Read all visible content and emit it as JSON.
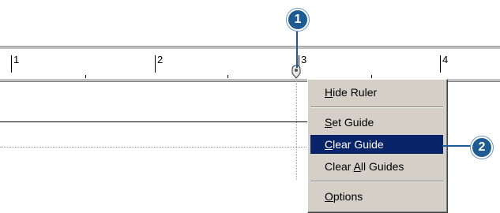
{
  "ruler": {
    "labels": [
      "1",
      "2",
      "3",
      "4"
    ]
  },
  "callouts": {
    "first": "1",
    "second": "2"
  },
  "context_menu": {
    "items": [
      {
        "pre": "",
        "accel": "H",
        "post": "ide Ruler"
      },
      {
        "pre": "",
        "accel": "S",
        "post": "et Guide"
      },
      {
        "pre": "",
        "accel": "C",
        "post": "lear Guide"
      },
      {
        "pre": "Clear ",
        "accel": "A",
        "post": "ll Guides"
      },
      {
        "pre": "",
        "accel": "O",
        "post": "ptions"
      }
    ],
    "selected_item": "Clear Guide"
  },
  "colors": {
    "callout": "#1f5b93",
    "menu_background": "#d4d0c8",
    "selection": "#0a246a",
    "guide": "#7fb2d9"
  }
}
